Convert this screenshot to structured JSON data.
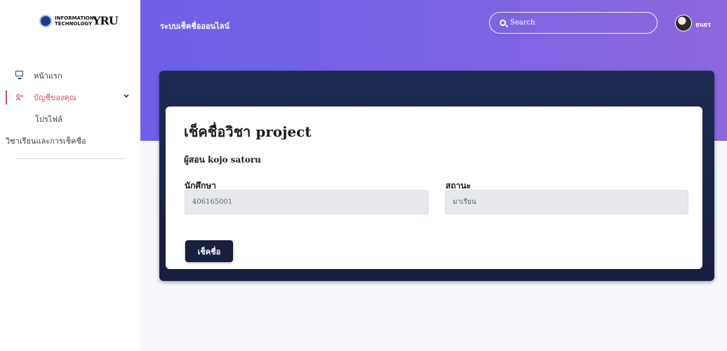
{
  "logo": {
    "line1": "INFORMATION",
    "line2": "TECHNOLOGY",
    "mark": "YRU"
  },
  "sidebar": {
    "items": [
      {
        "label": "หน้าแรก",
        "icon": "monitor-icon"
      },
      {
        "label": "บัญชีของคุณ",
        "icon": "user-account-icon",
        "active": true
      },
      {
        "label": "โปรไฟล์"
      },
      {
        "label": "วิชาเรียนและการเช็คชื่อ"
      }
    ]
  },
  "header": {
    "app_title": "ระบบเช็คชื่อออนไลน์",
    "search_placeholder": "Search",
    "username": "ธนธร"
  },
  "card": {
    "title": "เช็คชื่อวิชา project",
    "teacher": "ผู้สอน kojo satoru",
    "student_label": "นักศึกษา",
    "student_value": "406165001",
    "status_label": "สถานะ",
    "status_value": "มาเรียน",
    "button_label": "เช็คชื่อ"
  },
  "colors": {
    "accent_start": "#6c61e8",
    "accent_end": "#8d67dd",
    "panel": "#1d2a52",
    "active_nav": "#d8455a"
  }
}
